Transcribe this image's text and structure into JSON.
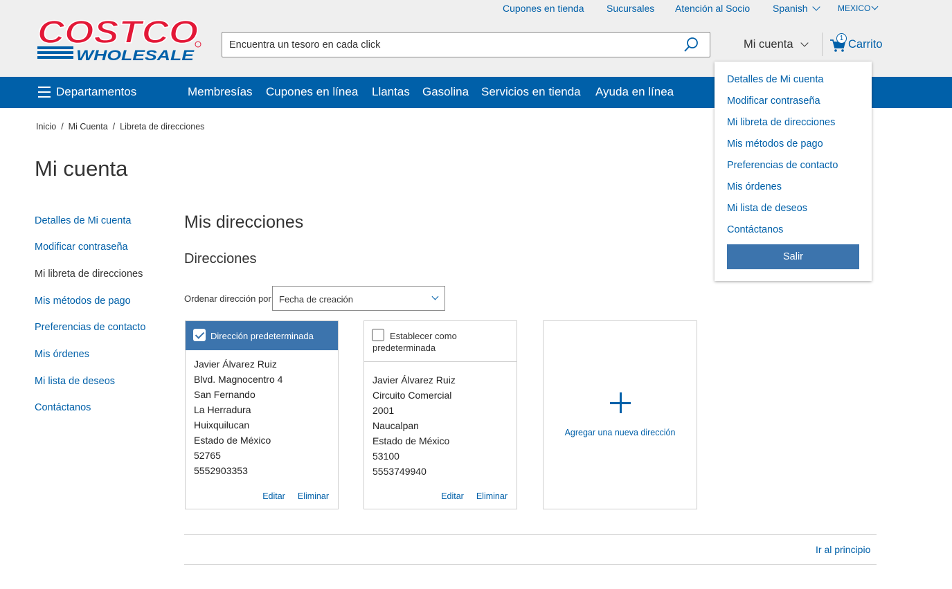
{
  "header": {
    "top_links": [
      "Cupones en tienda",
      "Sucursales",
      "Atención al Socio",
      "Spanish",
      "MEXICO"
    ],
    "logo_top": "COSTCO",
    "logo_bottom": "WHOLESALE",
    "search_placeholder": "Encuentra un tesoro en cada click",
    "account_label": "Mi cuenta",
    "cart_label": "Carrito",
    "cart_count": "1"
  },
  "nav": {
    "departments": "Departamentos",
    "items": [
      "Membresías",
      "Cupones en línea",
      "Llantas",
      "Gasolina",
      "Servicios en tienda",
      "Ayuda en línea"
    ]
  },
  "breadcrumb": [
    "Inicio",
    "Mi Cuenta",
    "Libreta de direcciones"
  ],
  "page_title": "Mi cuenta",
  "sidebar": {
    "items": [
      "Detalles de Mi cuenta",
      "Modificar contraseña",
      "Mi libreta de direcciones",
      "Mis métodos de pago",
      "Preferencias de contacto",
      "Mis órdenes",
      "Mi lista de deseos",
      "Contáctanos"
    ],
    "active_index": 2
  },
  "main": {
    "heading": "Mis direcciones",
    "subheading": "Direcciones",
    "sort_label": "Ordenar dirección por:",
    "sort_value": "Fecha de creación",
    "cards": [
      {
        "header": "Dirección predeterminada",
        "default": true,
        "lines": [
          "Javier Álvarez Ruiz",
          "Blvd. Magnocentro 4",
          "San Fernando",
          "La Herradura",
          "Huixquilucan",
          "Estado de México",
          "52765",
          "5552903353"
        ],
        "edit": "Editar",
        "delete": "Eliminar"
      },
      {
        "header": "Establecer como predeterminada",
        "default": false,
        "lines": [
          "Javier Álvarez Ruiz",
          "Circuito Comercial",
          "2001",
          "Naucalpan",
          "Estado de México",
          "53100",
          "5553749940"
        ],
        "edit": "Editar",
        "delete": "Eliminar"
      }
    ],
    "add_address": "Agregar una nueva dirección",
    "back_to_top": "Ir al principio"
  },
  "account_menu": {
    "items": [
      "Detalles de Mi cuenta",
      "Modificar contraseña",
      "Mi libreta de direcciones",
      "Mis métodos de pago",
      "Preferencias de contacto",
      "Mis órdenes",
      "Mi lista de deseos",
      "Contáctanos"
    ],
    "logout": "Salir"
  },
  "colors": {
    "brand_blue": "#0060a9",
    "button_blue": "#3c74ad",
    "logo_red": "#e31837",
    "header_bg": "#efefef"
  }
}
